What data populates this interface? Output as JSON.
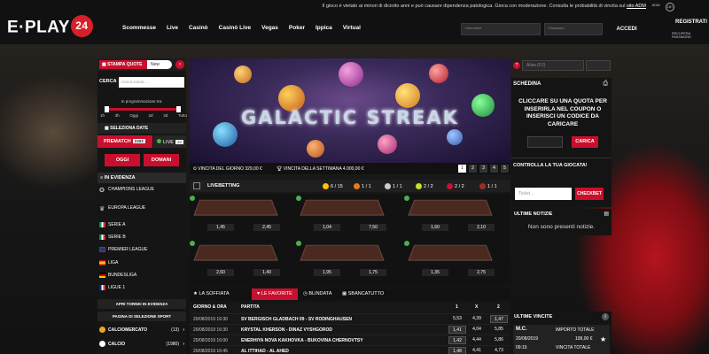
{
  "header": {
    "logo_text": "E·PLAY",
    "logo_num": "24",
    "notice": "Il gioco è vietato ai minori di diciotto anni e può causare dipendenza patologica. Gioca con moderazione. Consulta le probabilità di vincita sul",
    "notice_link": "sito ADM",
    "adm": "ADM",
    "plus18": "18+",
    "nav": [
      "Scommesse",
      "Live",
      "Casinò",
      "Casinò Live",
      "Vegas",
      "Poker",
      "Ippica",
      "Virtual"
    ],
    "username_placeholder": "Username",
    "password_placeholder": "Password",
    "accedi": "ACCEDI",
    "registrati": "REGISTRATI",
    "recupera": "RECUPERA PASSWORD"
  },
  "left": {
    "stampa": "STAMPA QUOTE",
    "new": "New",
    "chevron": "‹",
    "cerca_label": "CERCA",
    "cerca_placeholder": "Cerca eventi...",
    "programmazione": "In programmazione tra:",
    "ticks": [
      "1h",
      "3h",
      "Oggi",
      "2d",
      "3d",
      "Tutto"
    ],
    "slider_fraction": 1.0,
    "seleziona": "SELEZIONA DATE",
    "prematch": "PREMATCH",
    "prematch_count": "2303",
    "live": "LIVE",
    "live_count": "22",
    "oggi": "OGGI",
    "domani": "DOMANI",
    "inevidenza": "IN EVIDENZA",
    "events": [
      "CHAMPIONS LEAGUE",
      "EUROPA LEAGUE",
      "SERIE A",
      "SERIE B",
      "PREMIER LEAGUE",
      "LIGA",
      "BUNDESLIGA",
      "LIGUE 1"
    ],
    "apri": "APRI TORNEI IN EVIDENZA",
    "pagina": "PAGINA DI SELEZIONE SPORT",
    "sports": [
      {
        "name": "CALCIOMERCATO",
        "count": "(13)"
      },
      {
        "name": "CALCIO",
        "count": "(1980)"
      }
    ]
  },
  "banner": {
    "title": "GALACTIC STREAK",
    "vincita_giorno": "VINCITA DEL GIORNO 329,00 €",
    "vincita_settimana": "VINCITA DELLA SETTIMANA 4.000,00 €",
    "pages": [
      "1",
      "2",
      "3",
      "4",
      "5"
    ]
  },
  "livebetting": {
    "title": "LIVEBETTING",
    "stats": [
      "6 / 15",
      "1 / 1",
      "1 / 1",
      "2 / 2",
      "2 / 2",
      "1 / 1"
    ],
    "odds": [
      [
        "1,45",
        "2,45"
      ],
      [
        "1,04",
        "7,50"
      ],
      [
        "1,60",
        "2,10"
      ],
      [
        "2,60",
        "1,40"
      ],
      [
        "1,95",
        "1,75"
      ],
      [
        "1,35",
        "2,75"
      ]
    ]
  },
  "table": {
    "tabs": [
      "LA SOFFIATA",
      "LE FAVORITE",
      "BLINDATA",
      "SBANCATUTTO"
    ],
    "headers": [
      "GIORNO & ORA",
      "PARTITA",
      "1",
      "X",
      "2"
    ],
    "rows": [
      {
        "date": "20/08/2019 16:30",
        "match": "SV BERGISCH GLADBACH 09 - SV RODINGHAUSEN",
        "o1": "5,53",
        "ox": "4,39",
        "o2": "1,47"
      },
      {
        "date": "20/08/2019 16:30",
        "match": "KRYSTAL KHERSON - DINAZ VYSHGOROD",
        "o1": "1,41",
        "ox": "4,04",
        "o2": "5,85"
      },
      {
        "date": "20/08/2019 16:00",
        "match": "ENERHIYA NOVA KAKHOVKA - BUKOVINA CHERNOVTSY",
        "o1": "1,42",
        "ox": "4,44",
        "o2": "5,86"
      },
      {
        "date": "20/08/2019 16:45",
        "match": "AL ITTIHAD - AL AHED",
        "o1": "1,48",
        "ox": "4,41",
        "o2": "4,73"
      }
    ]
  },
  "right": {
    "alias": "Alias (F2)",
    "schedina": "SCHEDINA",
    "msg": "CLICCARE SU UNA QUOTA PER INSERIRLA NEL COUPON O INSERISCI UN CODICE DA CARICARE",
    "carica": "CARICA",
    "controlla": "CONTROLLA LA TUA GIOCATA!",
    "ticket_placeholder": "Ticket...",
    "checkbet": "CHECKBET",
    "ultime_notizie": "ULTIME NOTIZIE",
    "no_news": "Non sono presenti notizie.",
    "ultime_vincite": "ULTIME VINCITE",
    "card": {
      "name": "M.C.",
      "date": "20/08/2019",
      "time": "09:15",
      "importo_label": "IMPORTO TOTALE",
      "importo": "199,00 €",
      "vincita_label": "VINCITA TOTALE"
    }
  },
  "colors": {
    "accent": "#c8102e",
    "bg": "#111111"
  }
}
